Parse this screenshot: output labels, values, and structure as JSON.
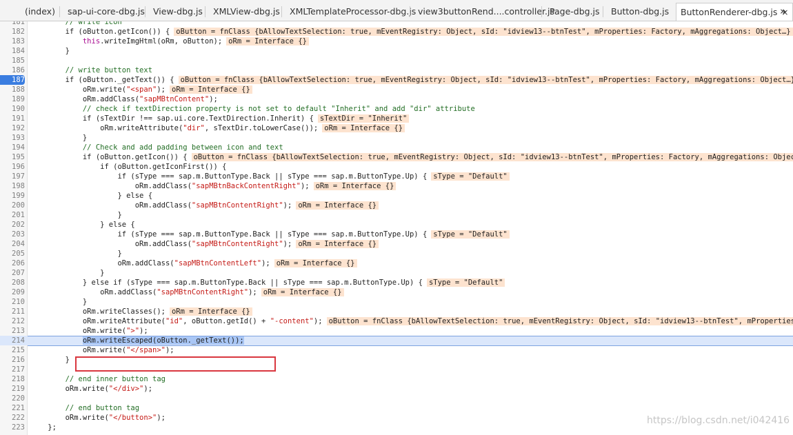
{
  "tabs": [
    {
      "label": "(index)"
    },
    {
      "label": "sap-ui-core-dbg.js"
    },
    {
      "label": "View-dbg.js"
    },
    {
      "label": "XMLView-dbg.js"
    },
    {
      "label": "XMLTemplateProcessor-dbg.js"
    },
    {
      "label": "view3buttonRend....controller.js"
    },
    {
      "label": "Page-dbg.js"
    },
    {
      "label": "Button-dbg.js"
    },
    {
      "label": "ButtonRenderer-dbg.js",
      "active": true
    }
  ],
  "tab_close_glyph": "×",
  "tab_overflow_glyph": "»",
  "breakpoint_line": "187",
  "current_line": "214",
  "lines": [
    {
      "n": "181",
      "indent": "        ",
      "segs": [
        {
          "t": "// write icon",
          "c": "cmt"
        }
      ]
    },
    {
      "n": "182",
      "indent": "        ",
      "segs": [
        {
          "t": "if (oButton.getIcon()) {"
        }
      ],
      "ann": "oButton = fnClass {bAllowTextSelection: true, mEventRegistry: Object, sId: \"idview13--btnTest\", mProperties: Factory, mAggregations: Object…}"
    },
    {
      "n": "183",
      "indent": "            ",
      "segs": [
        {
          "t": "this",
          "c": "kw"
        },
        {
          "t": ".writeImgHtml(oRm, oButton);"
        }
      ],
      "ann": "oRm = Interface {}"
    },
    {
      "n": "184",
      "indent": "        ",
      "segs": [
        {
          "t": "}"
        }
      ]
    },
    {
      "n": "185",
      "indent": "",
      "segs": []
    },
    {
      "n": "186",
      "indent": "        ",
      "segs": [
        {
          "t": "// write button text",
          "c": "cmt"
        }
      ]
    },
    {
      "n": "187",
      "indent": "        ",
      "segs": [
        {
          "t": "if (oButton._getText()) {"
        }
      ],
      "ann": "oButton = fnClass {bAllowTextSelection: true, mEventRegistry: Object, sId: \"idview13--btnTest\", mProperties: Factory, mAggregations: Object…}"
    },
    {
      "n": "188",
      "indent": "            ",
      "segs": [
        {
          "t": "oRm.write("
        },
        {
          "t": "\"<span\"",
          "c": "str"
        },
        {
          "t": ");"
        }
      ],
      "ann": "oRm = Interface {}"
    },
    {
      "n": "189",
      "indent": "            ",
      "segs": [
        {
          "t": "oRm.addClass("
        },
        {
          "t": "\"sapMBtnContent\"",
          "c": "str"
        },
        {
          "t": ");"
        }
      ]
    },
    {
      "n": "190",
      "indent": "            ",
      "segs": [
        {
          "t": "// check if textDirection property is not set to default \"Inherit\" and add \"dir\" attribute",
          "c": "cmt"
        }
      ]
    },
    {
      "n": "191",
      "indent": "            ",
      "segs": [
        {
          "t": "if (sTextDir !== sap.ui.core.TextDirection.Inherit) {"
        }
      ],
      "ann": "sTextDir = \"Inherit\""
    },
    {
      "n": "192",
      "indent": "                ",
      "segs": [
        {
          "t": "oRm.writeAttribute("
        },
        {
          "t": "\"dir\"",
          "c": "str"
        },
        {
          "t": ", sTextDir.toLowerCase());"
        }
      ],
      "ann": "oRm = Interface {}"
    },
    {
      "n": "193",
      "indent": "            ",
      "segs": [
        {
          "t": "}"
        }
      ]
    },
    {
      "n": "194",
      "indent": "            ",
      "segs": [
        {
          "t": "// Check and add padding between icon and text",
          "c": "cmt"
        }
      ]
    },
    {
      "n": "195",
      "indent": "            ",
      "segs": [
        {
          "t": "if (oButton.getIcon()) {"
        }
      ],
      "ann": "oButton = fnClass {bAllowTextSelection: true, mEventRegistry: Object, sId: \"idview13--btnTest\", mProperties: Factory, mAggregations: Object…}"
    },
    {
      "n": "196",
      "indent": "                ",
      "segs": [
        {
          "t": "if (oButton.getIconFirst()) {"
        }
      ]
    },
    {
      "n": "197",
      "indent": "                    ",
      "segs": [
        {
          "t": "if (sType === sap.m.ButtonType.Back || sType === sap.m.ButtonType.Up) {"
        }
      ],
      "ann": "sType = \"Default\""
    },
    {
      "n": "198",
      "indent": "                        ",
      "segs": [
        {
          "t": "oRm.addClass("
        },
        {
          "t": "\"sapMBtnBackContentRight\"",
          "c": "str"
        },
        {
          "t": ");"
        }
      ],
      "ann": "oRm = Interface {}"
    },
    {
      "n": "199",
      "indent": "                    ",
      "segs": [
        {
          "t": "} else {"
        }
      ]
    },
    {
      "n": "200",
      "indent": "                        ",
      "segs": [
        {
          "t": "oRm.addClass("
        },
        {
          "t": "\"sapMBtnContentRight\"",
          "c": "str"
        },
        {
          "t": ");"
        }
      ],
      "ann": "oRm = Interface {}"
    },
    {
      "n": "201",
      "indent": "                    ",
      "segs": [
        {
          "t": "}"
        }
      ]
    },
    {
      "n": "202",
      "indent": "                ",
      "segs": [
        {
          "t": "} else {"
        }
      ]
    },
    {
      "n": "203",
      "indent": "                    ",
      "segs": [
        {
          "t": "if (sType === sap.m.ButtonType.Back || sType === sap.m.ButtonType.Up) {"
        }
      ],
      "ann": "sType = \"Default\""
    },
    {
      "n": "204",
      "indent": "                        ",
      "segs": [
        {
          "t": "oRm.addClass("
        },
        {
          "t": "\"sapMBtnContentRight\"",
          "c": "str"
        },
        {
          "t": ");"
        }
      ],
      "ann": "oRm = Interface {}"
    },
    {
      "n": "205",
      "indent": "                    ",
      "segs": [
        {
          "t": "}"
        }
      ]
    },
    {
      "n": "206",
      "indent": "                    ",
      "segs": [
        {
          "t": "oRm.addClass("
        },
        {
          "t": "\"sapMBtnContentLeft\"",
          "c": "str"
        },
        {
          "t": ");"
        }
      ],
      "ann": "oRm = Interface {}"
    },
    {
      "n": "207",
      "indent": "                ",
      "segs": [
        {
          "t": "}"
        }
      ]
    },
    {
      "n": "208",
      "indent": "            ",
      "segs": [
        {
          "t": "} else if (sType === sap.m.ButtonType.Back || sType === sap.m.ButtonType.Up) {"
        }
      ],
      "ann": "sType = \"Default\""
    },
    {
      "n": "209",
      "indent": "                ",
      "segs": [
        {
          "t": "oRm.addClass("
        },
        {
          "t": "\"sapMBtnContentRight\"",
          "c": "str"
        },
        {
          "t": ");"
        }
      ],
      "ann": "oRm = Interface {}"
    },
    {
      "n": "210",
      "indent": "            ",
      "segs": [
        {
          "t": "}"
        }
      ]
    },
    {
      "n": "211",
      "indent": "            ",
      "segs": [
        {
          "t": "oRm.writeClasses();"
        }
      ],
      "ann": "oRm = Interface {}"
    },
    {
      "n": "212",
      "indent": "            ",
      "segs": [
        {
          "t": "oRm.writeAttribute("
        },
        {
          "t": "\"id\"",
          "c": "str"
        },
        {
          "t": ", oButton.getId() + "
        },
        {
          "t": "\"-content\"",
          "c": "str"
        },
        {
          "t": ");"
        }
      ],
      "ann": "oButton = fnClass {bAllowTextSelection: true, mEventRegistry: Object, sId: \"idview13--btnTest\", mProperties: Factory, mAggregations: Object…}"
    },
    {
      "n": "213",
      "indent": "            ",
      "segs": [
        {
          "t": "oRm.write("
        },
        {
          "t": "\">\"",
          "c": "str"
        },
        {
          "t": ");"
        }
      ]
    },
    {
      "n": "214",
      "indent": "            ",
      "segs": [
        {
          "t": "oRm.writeEscaped(oButton._getText());",
          "c": "sel"
        }
      ]
    },
    {
      "n": "215",
      "indent": "            ",
      "segs": [
        {
          "t": "oRm.write("
        },
        {
          "t": "\"</span>\"",
          "c": "str"
        },
        {
          "t": ");"
        }
      ]
    },
    {
      "n": "216",
      "indent": "        ",
      "segs": [
        {
          "t": "}"
        }
      ]
    },
    {
      "n": "217",
      "indent": "",
      "segs": []
    },
    {
      "n": "218",
      "indent": "        ",
      "segs": [
        {
          "t": "// end inner button tag",
          "c": "cmt"
        }
      ]
    },
    {
      "n": "219",
      "indent": "        ",
      "segs": [
        {
          "t": "oRm.write("
        },
        {
          "t": "\"</div>\"",
          "c": "str"
        },
        {
          "t": ");"
        }
      ]
    },
    {
      "n": "220",
      "indent": "",
      "segs": []
    },
    {
      "n": "221",
      "indent": "        ",
      "segs": [
        {
          "t": "// end button tag",
          "c": "cmt"
        }
      ]
    },
    {
      "n": "222",
      "indent": "        ",
      "segs": [
        {
          "t": "oRm.write("
        },
        {
          "t": "\"</button>\"",
          "c": "str"
        },
        {
          "t": ");"
        }
      ]
    },
    {
      "n": "223",
      "indent": "    ",
      "segs": [
        {
          "t": "};"
        }
      ]
    }
  ],
  "watermark": "https://blog.csdn.net/i042416",
  "colors": {
    "comment": "#236e25",
    "string": "#c41a16",
    "keyword": "#a90d91",
    "annotation_bg": "#fde3cf",
    "breakpoint": "#3a7de0",
    "current_line_bg": "#dbe7fb",
    "highlight_box": "#d9363e"
  }
}
